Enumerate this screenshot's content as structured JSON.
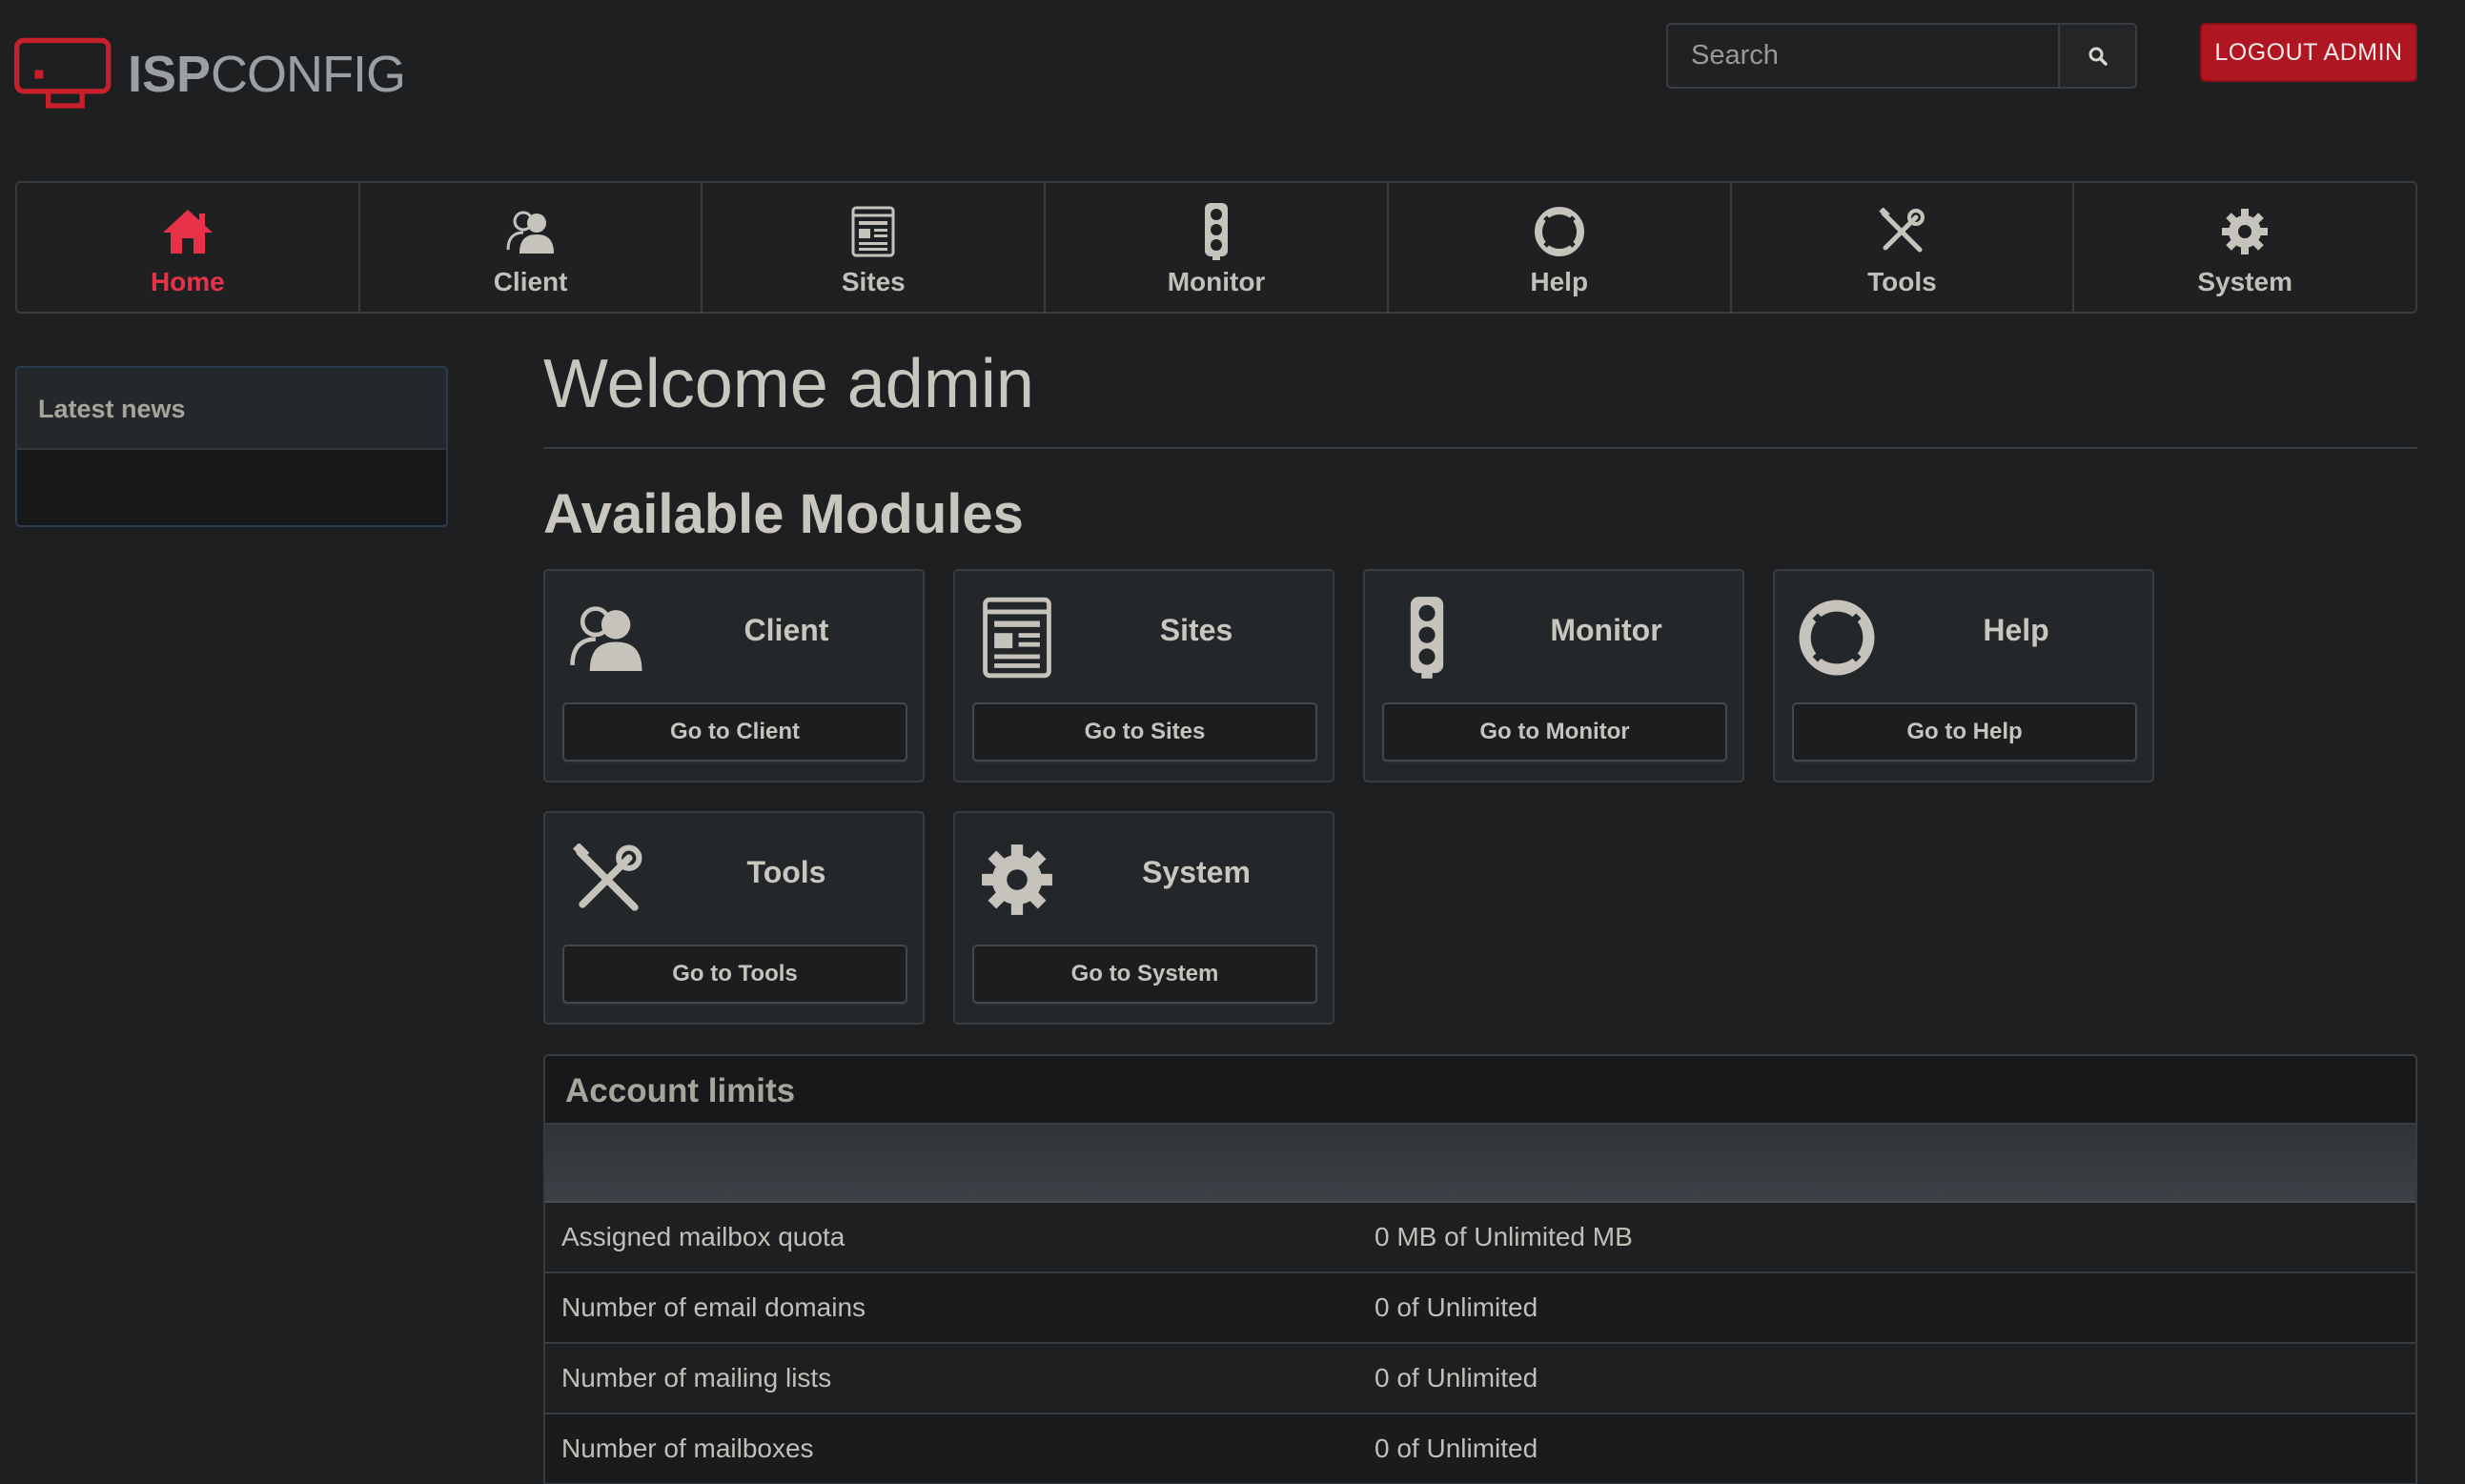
{
  "header": {
    "logo": {
      "bold": "ISP",
      "light": "CONFIG"
    },
    "search": {
      "placeholder": "Search"
    },
    "logout_label": "LOGOUT ADMIN"
  },
  "nav": {
    "items": [
      {
        "label": "Home",
        "icon": "home-icon",
        "active": true
      },
      {
        "label": "Client",
        "icon": "client-icon"
      },
      {
        "label": "Sites",
        "icon": "sites-icon"
      },
      {
        "label": "Monitor",
        "icon": "monitor-icon"
      },
      {
        "label": "Help",
        "icon": "help-icon"
      },
      {
        "label": "Tools",
        "icon": "tools-icon"
      },
      {
        "label": "System",
        "icon": "system-icon"
      }
    ]
  },
  "sidebar": {
    "news_title": "Latest news"
  },
  "main": {
    "welcome": "Welcome admin",
    "modules_title": "Available Modules",
    "modules": [
      {
        "title": "Client",
        "button": "Go to Client",
        "icon": "client-icon"
      },
      {
        "title": "Sites",
        "button": "Go to Sites",
        "icon": "sites-icon"
      },
      {
        "title": "Monitor",
        "button": "Go to Monitor",
        "icon": "monitor-icon"
      },
      {
        "title": "Help",
        "button": "Go to Help",
        "icon": "help-icon"
      },
      {
        "title": "Tools",
        "button": "Go to Tools",
        "icon": "tools-icon"
      },
      {
        "title": "System",
        "button": "Go to System",
        "icon": "system-icon"
      }
    ]
  },
  "limits": {
    "title": "Account limits",
    "rows": [
      {
        "label": "Assigned mailbox quota",
        "value": "0 MB of Unlimited MB"
      },
      {
        "label": "Number of email domains",
        "value": "0 of Unlimited"
      },
      {
        "label": "Number of mailing lists",
        "value": "0 of Unlimited"
      },
      {
        "label": "Number of mailboxes",
        "value": "0 of Unlimited"
      }
    ]
  },
  "colors": {
    "accent": "#e8324a",
    "logout": "#b01621",
    "background": "#1d1f21"
  }
}
